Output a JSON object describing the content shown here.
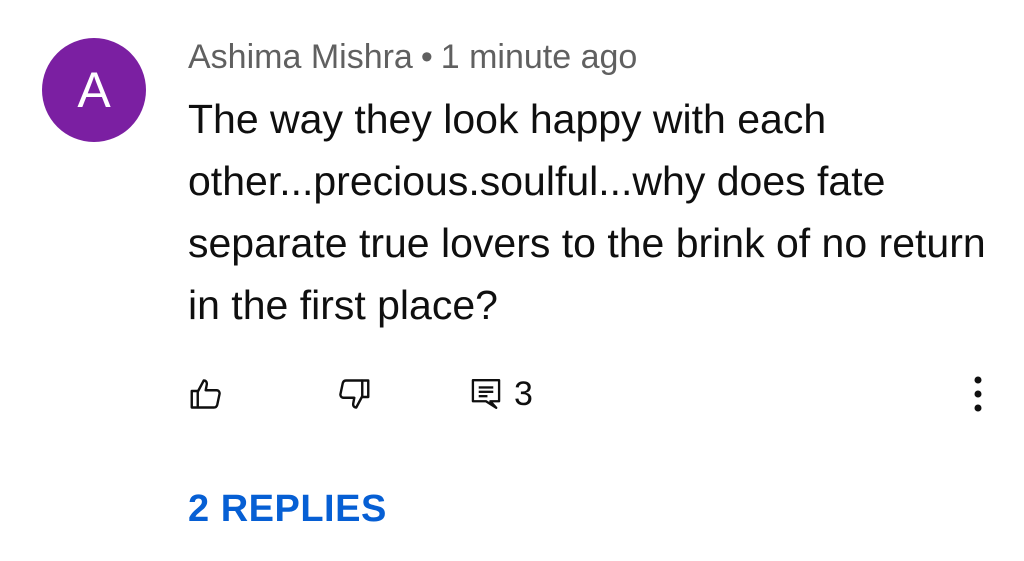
{
  "comment": {
    "avatar_letter": "A",
    "avatar_color": "#7b1fa2",
    "author": "Ashima Mishra",
    "separator": "•",
    "timestamp": "1 minute ago",
    "text": "The way they look happy with each other...precious.soulful...why does fate separate true lovers to the brink of no return in the first place?",
    "reply_count": "3",
    "replies_label": "2 REPLIES"
  },
  "icons": {
    "like": "thumbs-up-icon",
    "dislike": "thumbs-down-icon",
    "reply": "comment-icon",
    "more": "more-vertical-icon"
  },
  "colors": {
    "link": "#065fd4",
    "meta_text": "#606060",
    "body_text": "#0f0f0f"
  }
}
